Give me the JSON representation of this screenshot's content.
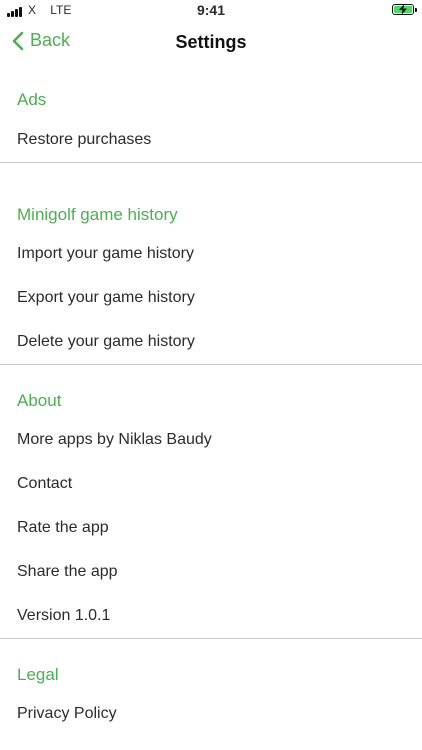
{
  "status_bar": {
    "carrier": "X",
    "network": "LTE",
    "time": "9:41"
  },
  "nav": {
    "back_label": "Back",
    "title": "Settings"
  },
  "colors": {
    "accent": "#4caf50",
    "divider": "#c8c8c8",
    "battery": "#4cd964"
  },
  "sections": [
    {
      "header": "Ads",
      "items": [
        "Restore purchases"
      ]
    },
    {
      "header": "Minigolf game history",
      "items": [
        "Import your game history",
        "Export your game history",
        "Delete your game history"
      ]
    },
    {
      "header": "About",
      "items": [
        "More apps by Niklas Baudy",
        "Contact",
        "Rate the app",
        "Share the app",
        "Version 1.0.1"
      ]
    },
    {
      "header": "Legal",
      "items": [
        "Privacy Policy"
      ]
    }
  ]
}
